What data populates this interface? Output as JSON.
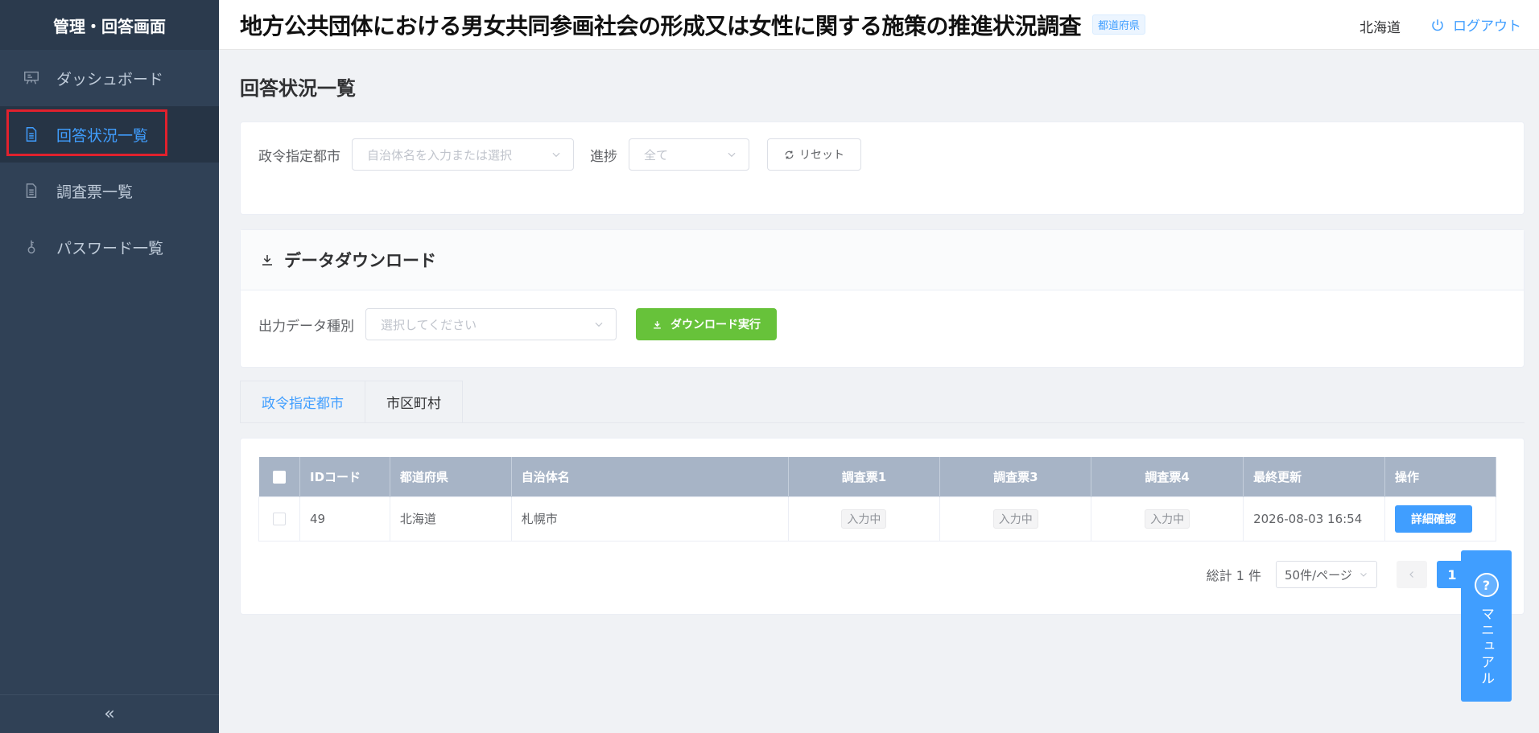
{
  "sidebar": {
    "title": "管理・回答画面",
    "items": [
      {
        "label": "ダッシュボード",
        "icon": "presentation-icon"
      },
      {
        "label": "回答状況一覧",
        "icon": "document-icon"
      },
      {
        "label": "調査票一覧",
        "icon": "document-icon"
      },
      {
        "label": "パスワード一覧",
        "icon": "key-icon"
      }
    ],
    "active_index": 1,
    "collapse_glyph": "«"
  },
  "header": {
    "title": "地方公共団体における男女共同参画社会の形成又は女性に関する施策の推進状況調査",
    "badge": "都道府県",
    "user": "北海道",
    "logout": "ログアウト"
  },
  "page": {
    "title": "回答状況一覧"
  },
  "filters": {
    "city_label": "政令指定都市",
    "city_placeholder": "自治体名を入力または選択",
    "progress_label": "進捗",
    "progress_value": "全て",
    "reset_label": "リセット"
  },
  "download": {
    "title": "データダウンロード",
    "type_label": "出力データ種別",
    "type_placeholder": "選択してください",
    "button_label": "ダウンロード実行"
  },
  "tabs": [
    "政令指定都市",
    "市区町村"
  ],
  "table": {
    "headers": [
      "IDコード",
      "都道府県",
      "自治体名",
      "調査票1",
      "調査票3",
      "調査票4",
      "最終更新",
      "操作"
    ],
    "rows": [
      {
        "id": "49",
        "prefecture": "北海道",
        "municipality": "札幌市",
        "survey1": "入力中",
        "survey3": "入力中",
        "survey4": "入力中",
        "updated": "2026-08-03 16:54",
        "action": "詳細確認"
      }
    ]
  },
  "pagination": {
    "total": "総計 1 件",
    "page_size": "50件/ページ",
    "current_page": "1"
  },
  "manual": {
    "icon_glyph": "?",
    "label": "マニュアル"
  },
  "colors": {
    "sidebar_bg": "#304156",
    "accent": "#409eff",
    "success": "#67c23a",
    "highlight": "#e0212d"
  }
}
